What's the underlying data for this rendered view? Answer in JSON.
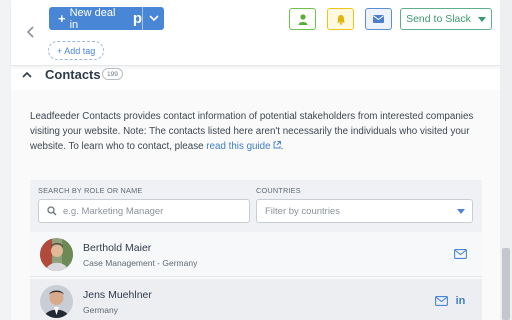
{
  "toolbar": {
    "new_deal_label": "New deal in",
    "new_deal_brand": "p",
    "add_tag_label": "+ Add tag",
    "send_to_slack_label": "Send to Slack"
  },
  "section": {
    "title": "Contacts",
    "count": "199"
  },
  "description": {
    "text": "Leadfeeder Contacts provides contact information of potential stakeholders from interested companies visiting your website. Note: The contacts listed here aren't necessarily the individuals who visited your website. To learn who to contact, please ",
    "link_label": "read this guide",
    "trailing": "."
  },
  "search": {
    "role_label": "SEARCH BY ROLE OR NAME",
    "role_placeholder": "e.g. Marketing Manager",
    "countries_label": "COUNTRIES",
    "countries_placeholder": "Filter by countries"
  },
  "contacts": [
    {
      "name": "Berthold Maier",
      "subtitle": "Case Management - Germany",
      "has_email": true,
      "has_linkedin": false
    },
    {
      "name": "Jens Muehlner",
      "subtitle": "Germany",
      "has_email": true,
      "has_linkedin": true
    }
  ],
  "colors": {
    "accent_blue": "#4a86d6",
    "green": "#6cc24a",
    "yellow": "#f0c419",
    "slack_green": "#3a9a6e"
  },
  "icons": {
    "back": "chevron-left-icon",
    "new_deal_caret": "chevron-down-icon",
    "person": "person-icon",
    "bell": "bell-icon",
    "mail": "mail-icon",
    "slack_caret": "caret-down-icon",
    "collapse": "chevron-up-icon",
    "search": "search-icon",
    "linkedin": "linkedin-icon",
    "external_link": "external-link-icon"
  }
}
